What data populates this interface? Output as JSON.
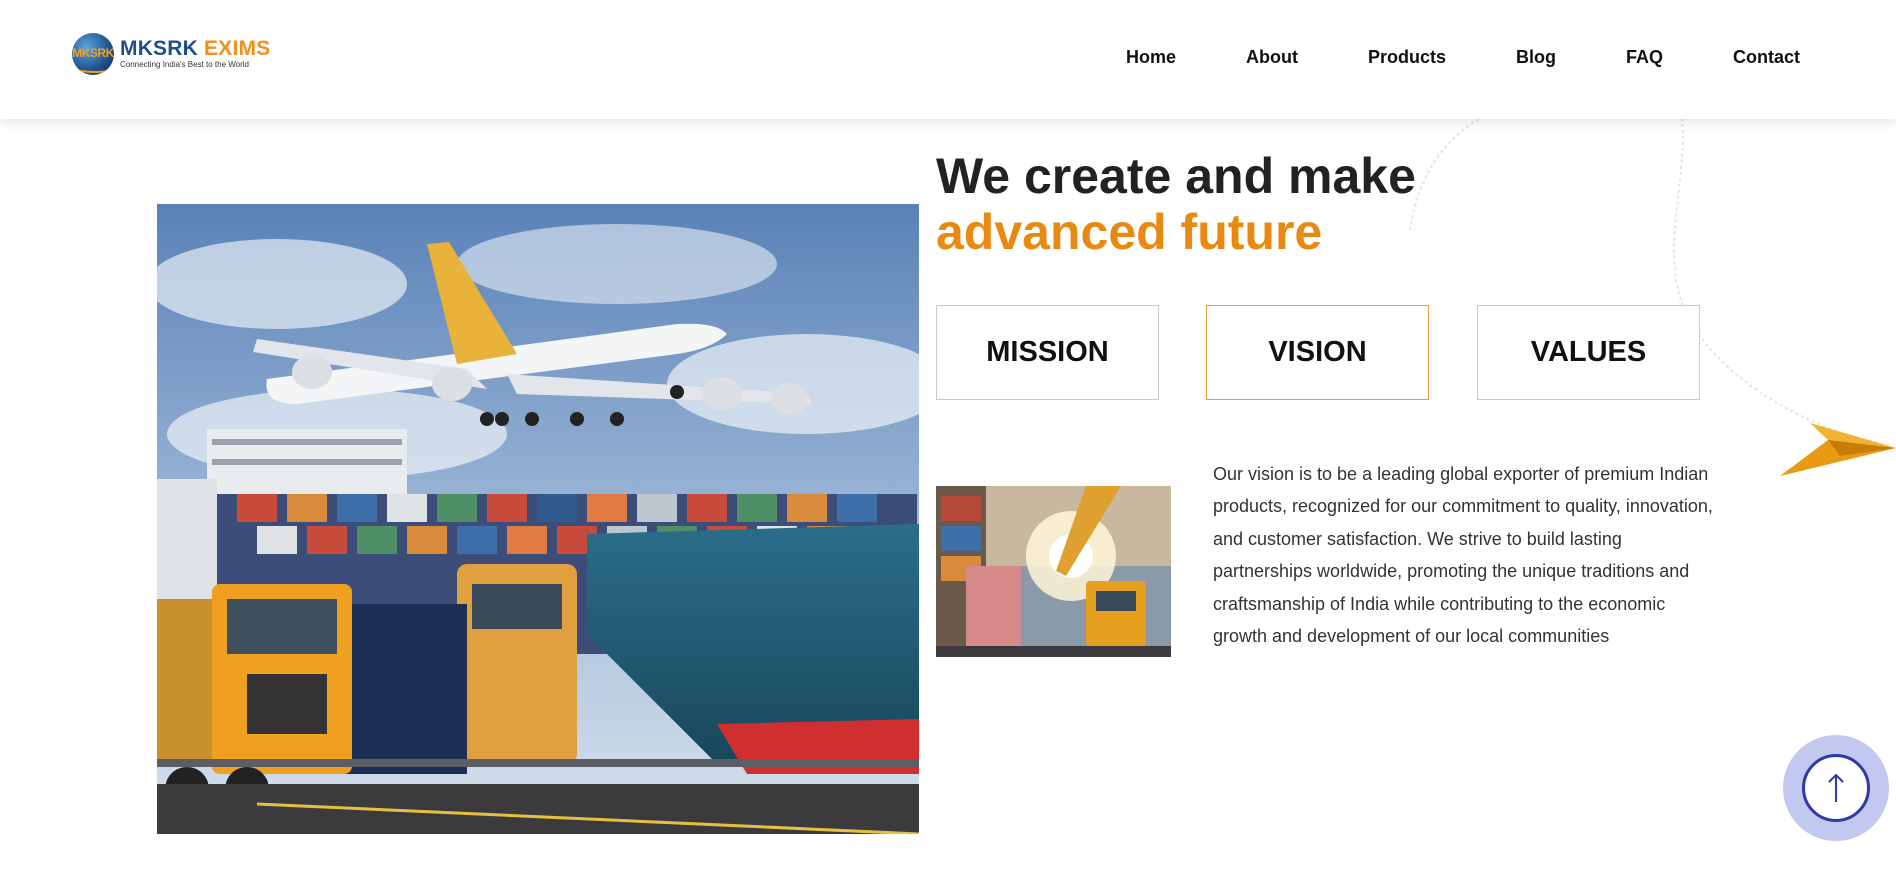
{
  "brand": {
    "logo_mark": "MKSRK",
    "name_part1": "MKSRK",
    "name_part2": "EXIMS",
    "tagline": "Connecting India's Best to the World"
  },
  "nav": {
    "items": [
      "Home",
      "About",
      "Products",
      "Blog",
      "FAQ",
      "Contact"
    ]
  },
  "hero": {
    "heading_line1": "We create and make",
    "heading_line2": "advanced future",
    "image_desc": "airplane-ship-train-truck-image"
  },
  "tabs": {
    "mission": "MISSION",
    "vision": "VISION",
    "values": "VALUES",
    "active": "VISION"
  },
  "content": {
    "image_desc": "port-logistics-image",
    "paragraph": "Our vision is to be a leading global exporter of premium Indian products, recognized for our commitment to quality, innovation, and customer satisfaction. We strive to build lasting partnerships worldwide, promoting the unique traditions and craftsmanship of India while contributing to the economic growth and development of our local communities"
  },
  "colors": {
    "accent": "#e88a12",
    "brand_blue": "#1f4f8a",
    "scroll_button": "#2e3aa8",
    "scroll_button_halo": "#c3c8f0"
  },
  "icons": {
    "scroll_top": "arrow-up-icon",
    "decor": "paper-plane-icon"
  }
}
